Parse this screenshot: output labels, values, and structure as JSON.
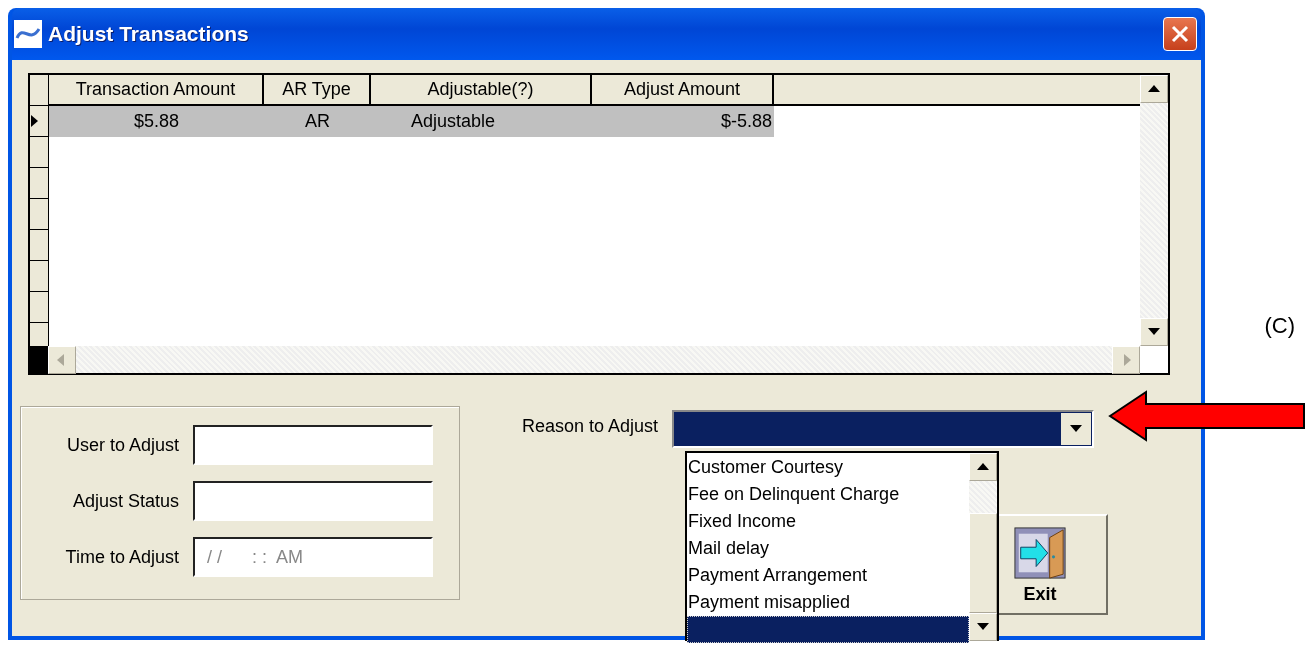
{
  "window": {
    "title": "Adjust Transactions"
  },
  "grid": {
    "columns": [
      "Transaction Amount",
      "AR Type",
      "Adjustable(?)",
      "Adjust Amount"
    ],
    "rows": [
      {
        "cells": [
          "$5.88",
          "AR",
          "Adjustable",
          "$-5.88"
        ],
        "selected": true
      }
    ]
  },
  "form": {
    "fields": [
      {
        "label": "User to Adjust"
      },
      {
        "label": "Adjust Status"
      },
      {
        "label": "Time to Adjust",
        "placeholder": "/ /      : :  AM"
      }
    ]
  },
  "reason": {
    "label": "Reason to Adjust",
    "expanded": true,
    "options": [
      {
        "label": "Customer Courtesy",
        "selected": false
      },
      {
        "label": "Fee on Delinquent Charge",
        "selected": false
      },
      {
        "label": "Fixed Income",
        "selected": false
      },
      {
        "label": "Mail delay",
        "selected": false
      },
      {
        "label": "Payment Arrangement",
        "selected": false
      },
      {
        "label": "Payment misapplied",
        "selected": false
      },
      {
        "selected": true
      }
    ]
  },
  "exit_button": {
    "label": "Exit"
  },
  "figure_label": "(C)"
}
